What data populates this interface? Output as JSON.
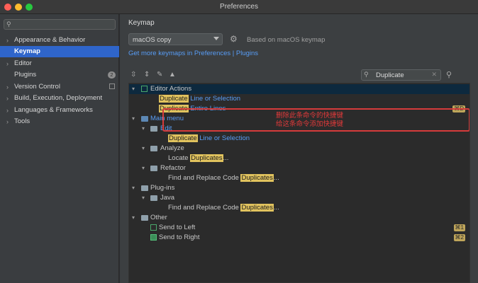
{
  "window": {
    "title": "Preferences"
  },
  "sidebar": {
    "items": [
      {
        "label": "Appearance & Behavior"
      },
      {
        "label": "Keymap"
      },
      {
        "label": "Editor"
      },
      {
        "label": "Plugins",
        "badge": "2"
      },
      {
        "label": "Version Control"
      },
      {
        "label": "Build, Execution, Deployment"
      },
      {
        "label": "Languages & Frameworks"
      },
      {
        "label": "Tools"
      }
    ]
  },
  "main": {
    "heading": "Keymap",
    "keymap_select": "macOS copy",
    "based_on": "Based on macOS keymap",
    "more_link": "Get more keymaps in Preferences | Plugins",
    "search_value": "Duplicate"
  },
  "tree": {
    "editor_actions": "Editor Actions",
    "dup_word": "Duplicate",
    "line_sel": "Line or Selection",
    "entire_lines": "Entire Lines",
    "dup_sc": "⌘D",
    "main_menu": "Main menu",
    "edit": "Edit",
    "analyze": "Analyze",
    "locate": "Locate",
    "duplicates": "Duplicates",
    "ellipsis": "...",
    "refactor": "Refactor",
    "find_replace": "Find and Replace Code",
    "plugins": "Plug-ins",
    "java": "Java",
    "other": "Other",
    "send_left": "Send to Left",
    "send_left_sc": "⌘1",
    "send_right": "Send to Right",
    "send_right_sc": "⌘2"
  },
  "annotation": {
    "line1": "删除此条命令的快捷键",
    "line2": "给这条命令添加快捷键",
    "color": "#d63b3b"
  },
  "colors": {
    "accent": "#2f65ca",
    "link": "#589df6",
    "highlight": "#e1c35e"
  }
}
